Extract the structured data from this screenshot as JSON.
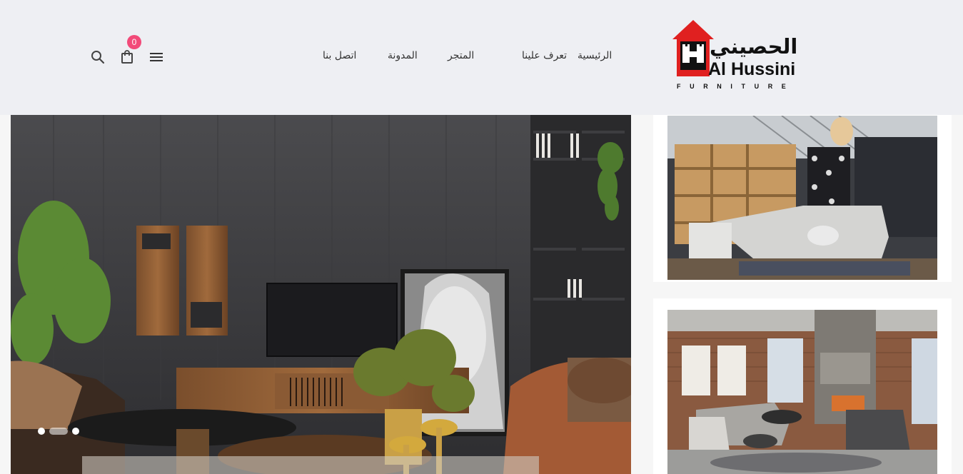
{
  "brand": {
    "name_ar": "الحصيني",
    "name_en": "Al Hussini",
    "tagline": "FURNITURE",
    "accent_color": "#e02020"
  },
  "nav": {
    "items": [
      {
        "label": "الرئيسية"
      },
      {
        "label": "تعرف علينا"
      },
      {
        "label": "المتجر"
      },
      {
        "label": "المدونة"
      },
      {
        "label": "اتصل بنا"
      }
    ]
  },
  "header_icons": {
    "menu": "menu-icon",
    "cart": "shopping-bag-icon",
    "cart_count": "0",
    "search": "search-icon",
    "badge_color": "#f24a79"
  },
  "hero": {
    "slides_count": 3,
    "active_slide": 2
  }
}
